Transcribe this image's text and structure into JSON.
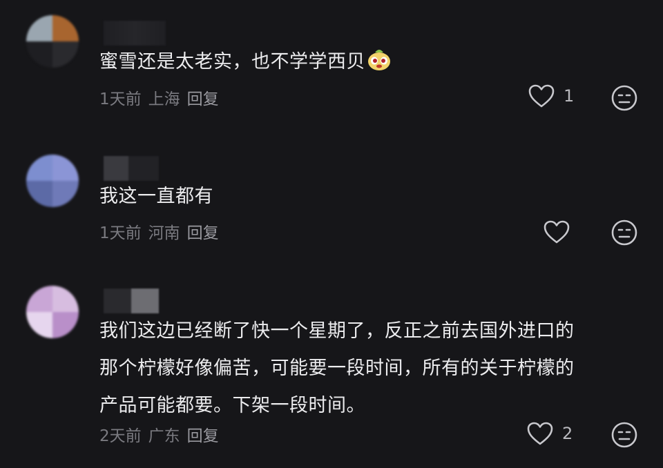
{
  "comments": [
    {
      "text": "蜜雪还是太老实，也不学学西贝",
      "time": "1天前",
      "location": "上海",
      "reply_label": "回复",
      "like_count": "1",
      "emoji": "mascot-emoji"
    },
    {
      "text": "我这一直都有",
      "time": "1天前",
      "location": "河南",
      "reply_label": "回复",
      "like_count": ""
    },
    {
      "text_lines": [
        "我们这边已经断了快一个星期了，反正之前去国外进口的",
        "那个柠檬好像偏苦，可能要一段时间，所有的关于柠檬的",
        "产品可能都要。下架一段时间。"
      ],
      "time": "2天前",
      "location": "广东",
      "reply_label": "回复",
      "like_count": "2"
    }
  ],
  "icons": {
    "like": "heart-outline-icon",
    "dislike": "neutral-face-icon"
  },
  "colors": {
    "background": "#161619",
    "text": "#ececee",
    "meta": "#7a7a80",
    "icon": "#c8c8cd"
  }
}
